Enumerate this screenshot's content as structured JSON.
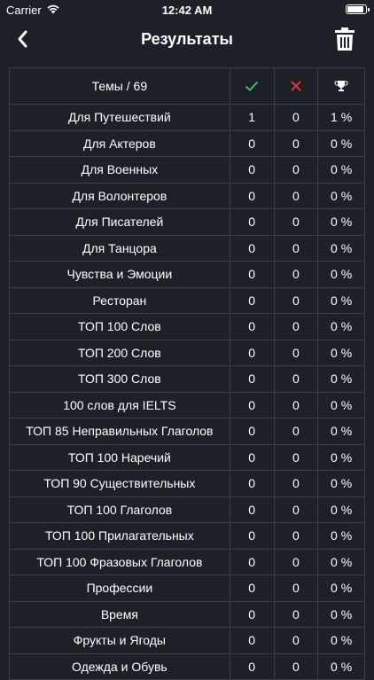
{
  "status_bar": {
    "carrier": "Carrier",
    "time": "12:42 AM"
  },
  "nav": {
    "title": "Результаты"
  },
  "colors": {
    "background": "#1d2027",
    "grid": "#3b3f47",
    "check": "#3cc26b",
    "cross": "#e0353f"
  },
  "table": {
    "topics_header": "Темы / 69",
    "rows": [
      {
        "topic": "Для Путешествий",
        "correct": "1",
        "wrong": "0",
        "percent": "1 %"
      },
      {
        "topic": "Для Актеров",
        "correct": "0",
        "wrong": "0",
        "percent": "0 %"
      },
      {
        "topic": "Для Военных",
        "correct": "0",
        "wrong": "0",
        "percent": "0 %"
      },
      {
        "topic": "Для Волонтеров",
        "correct": "0",
        "wrong": "0",
        "percent": "0 %"
      },
      {
        "topic": "Для Писателей",
        "correct": "0",
        "wrong": "0",
        "percent": "0 %"
      },
      {
        "topic": "Для Танцора",
        "correct": "0",
        "wrong": "0",
        "percent": "0 %"
      },
      {
        "topic": "Чувства и Эмоции",
        "correct": "0",
        "wrong": "0",
        "percent": "0 %"
      },
      {
        "topic": "Ресторан",
        "correct": "0",
        "wrong": "0",
        "percent": "0 %"
      },
      {
        "topic": "ТОП 100 Слов",
        "correct": "0",
        "wrong": "0",
        "percent": "0 %"
      },
      {
        "topic": "ТОП 200 Слов",
        "correct": "0",
        "wrong": "0",
        "percent": "0 %"
      },
      {
        "topic": "ТОП 300 Слов",
        "correct": "0",
        "wrong": "0",
        "percent": "0 %"
      },
      {
        "topic": "100 слов для IELTS",
        "correct": "0",
        "wrong": "0",
        "percent": "0 %"
      },
      {
        "topic": "ТОП 85 Неправильных Глаголов",
        "correct": "0",
        "wrong": "0",
        "percent": "0 %"
      },
      {
        "topic": "ТОП 100 Наречий",
        "correct": "0",
        "wrong": "0",
        "percent": "0 %"
      },
      {
        "topic": "ТОП 90 Существительных",
        "correct": "0",
        "wrong": "0",
        "percent": "0 %"
      },
      {
        "topic": "ТОП 100 Глаголов",
        "correct": "0",
        "wrong": "0",
        "percent": "0 %"
      },
      {
        "topic": "ТОП 100 Прилагательных",
        "correct": "0",
        "wrong": "0",
        "percent": "0 %"
      },
      {
        "topic": "ТОП 100 Фразовых Глаголов",
        "correct": "0",
        "wrong": "0",
        "percent": "0 %"
      },
      {
        "topic": "Профессии",
        "correct": "0",
        "wrong": "0",
        "percent": "0 %"
      },
      {
        "topic": "Время",
        "correct": "0",
        "wrong": "0",
        "percent": "0 %"
      },
      {
        "topic": "Фрукты и Ягоды",
        "correct": "0",
        "wrong": "0",
        "percent": "0 %"
      },
      {
        "topic": "Одежда и Обувь",
        "correct": "0",
        "wrong": "0",
        "percent": "0 %"
      }
    ]
  }
}
